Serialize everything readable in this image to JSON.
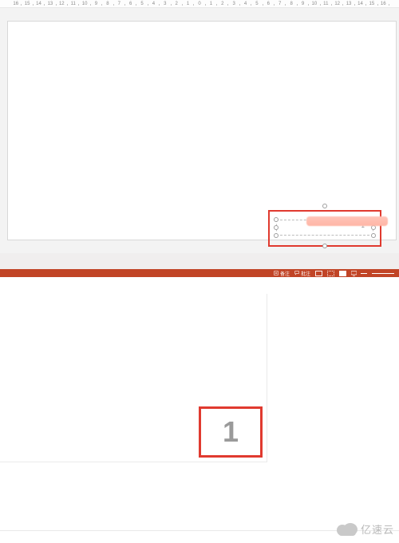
{
  "ruler": {
    "ticks": [
      16,
      15,
      14,
      13,
      12,
      11,
      10,
      9,
      8,
      7,
      6,
      5,
      4,
      3,
      2,
      1,
      0,
      1,
      2,
      3,
      4,
      5,
      6,
      7,
      8,
      9,
      10,
      11,
      12,
      13,
      14,
      15,
      16
    ]
  },
  "placeholder": {
    "page_number": "1"
  },
  "statusbar": {
    "notes_label": "备注",
    "comments_label": "批注"
  },
  "thumbnail": {
    "big_number": "1"
  },
  "watermark": {
    "text": "亿速云"
  }
}
